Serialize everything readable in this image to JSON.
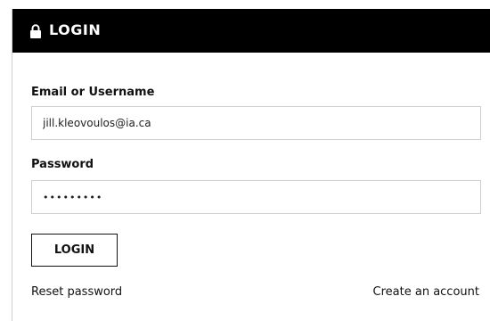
{
  "header": {
    "title": "LOGIN",
    "icon": "lock-icon",
    "background": "#000000",
    "text_color": "#ffffff"
  },
  "form": {
    "email_label": "Email or Username",
    "email_value": "jill.kleovoulos@ia.ca",
    "password_label": "Password",
    "password_value": "•••••••••",
    "submit_label": "LOGIN"
  },
  "links": {
    "reset_password": "Reset password",
    "create_account": "Create an account"
  }
}
